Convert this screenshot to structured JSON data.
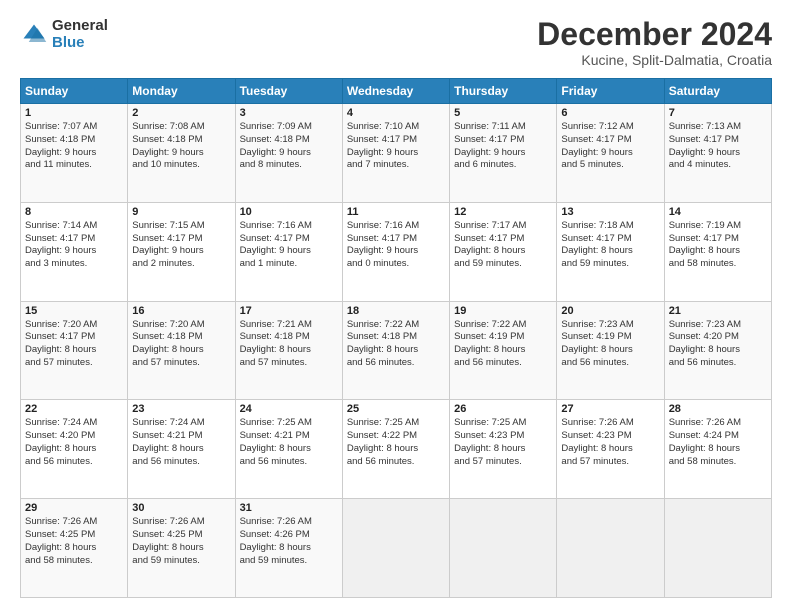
{
  "header": {
    "logo_general": "General",
    "logo_blue": "Blue",
    "month_title": "December 2024",
    "location": "Kucine, Split-Dalmatia, Croatia"
  },
  "days_of_week": [
    "Sunday",
    "Monday",
    "Tuesday",
    "Wednesday",
    "Thursday",
    "Friday",
    "Saturday"
  ],
  "weeks": [
    [
      {
        "day": "1",
        "lines": [
          "Sunrise: 7:07 AM",
          "Sunset: 4:18 PM",
          "Daylight: 9 hours",
          "and 11 minutes."
        ]
      },
      {
        "day": "2",
        "lines": [
          "Sunrise: 7:08 AM",
          "Sunset: 4:18 PM",
          "Daylight: 9 hours",
          "and 10 minutes."
        ]
      },
      {
        "day": "3",
        "lines": [
          "Sunrise: 7:09 AM",
          "Sunset: 4:18 PM",
          "Daylight: 9 hours",
          "and 8 minutes."
        ]
      },
      {
        "day": "4",
        "lines": [
          "Sunrise: 7:10 AM",
          "Sunset: 4:17 PM",
          "Daylight: 9 hours",
          "and 7 minutes."
        ]
      },
      {
        "day": "5",
        "lines": [
          "Sunrise: 7:11 AM",
          "Sunset: 4:17 PM",
          "Daylight: 9 hours",
          "and 6 minutes."
        ]
      },
      {
        "day": "6",
        "lines": [
          "Sunrise: 7:12 AM",
          "Sunset: 4:17 PM",
          "Daylight: 9 hours",
          "and 5 minutes."
        ]
      },
      {
        "day": "7",
        "lines": [
          "Sunrise: 7:13 AM",
          "Sunset: 4:17 PM",
          "Daylight: 9 hours",
          "and 4 minutes."
        ]
      }
    ],
    [
      {
        "day": "8",
        "lines": [
          "Sunrise: 7:14 AM",
          "Sunset: 4:17 PM",
          "Daylight: 9 hours",
          "and 3 minutes."
        ]
      },
      {
        "day": "9",
        "lines": [
          "Sunrise: 7:15 AM",
          "Sunset: 4:17 PM",
          "Daylight: 9 hours",
          "and 2 minutes."
        ]
      },
      {
        "day": "10",
        "lines": [
          "Sunrise: 7:16 AM",
          "Sunset: 4:17 PM",
          "Daylight: 9 hours",
          "and 1 minute."
        ]
      },
      {
        "day": "11",
        "lines": [
          "Sunrise: 7:16 AM",
          "Sunset: 4:17 PM",
          "Daylight: 9 hours",
          "and 0 minutes."
        ]
      },
      {
        "day": "12",
        "lines": [
          "Sunrise: 7:17 AM",
          "Sunset: 4:17 PM",
          "Daylight: 8 hours",
          "and 59 minutes."
        ]
      },
      {
        "day": "13",
        "lines": [
          "Sunrise: 7:18 AM",
          "Sunset: 4:17 PM",
          "Daylight: 8 hours",
          "and 59 minutes."
        ]
      },
      {
        "day": "14",
        "lines": [
          "Sunrise: 7:19 AM",
          "Sunset: 4:17 PM",
          "Daylight: 8 hours",
          "and 58 minutes."
        ]
      }
    ],
    [
      {
        "day": "15",
        "lines": [
          "Sunrise: 7:20 AM",
          "Sunset: 4:17 PM",
          "Daylight: 8 hours",
          "and 57 minutes."
        ]
      },
      {
        "day": "16",
        "lines": [
          "Sunrise: 7:20 AM",
          "Sunset: 4:18 PM",
          "Daylight: 8 hours",
          "and 57 minutes."
        ]
      },
      {
        "day": "17",
        "lines": [
          "Sunrise: 7:21 AM",
          "Sunset: 4:18 PM",
          "Daylight: 8 hours",
          "and 57 minutes."
        ]
      },
      {
        "day": "18",
        "lines": [
          "Sunrise: 7:22 AM",
          "Sunset: 4:18 PM",
          "Daylight: 8 hours",
          "and 56 minutes."
        ]
      },
      {
        "day": "19",
        "lines": [
          "Sunrise: 7:22 AM",
          "Sunset: 4:19 PM",
          "Daylight: 8 hours",
          "and 56 minutes."
        ]
      },
      {
        "day": "20",
        "lines": [
          "Sunrise: 7:23 AM",
          "Sunset: 4:19 PM",
          "Daylight: 8 hours",
          "and 56 minutes."
        ]
      },
      {
        "day": "21",
        "lines": [
          "Sunrise: 7:23 AM",
          "Sunset: 4:20 PM",
          "Daylight: 8 hours",
          "and 56 minutes."
        ]
      }
    ],
    [
      {
        "day": "22",
        "lines": [
          "Sunrise: 7:24 AM",
          "Sunset: 4:20 PM",
          "Daylight: 8 hours",
          "and 56 minutes."
        ]
      },
      {
        "day": "23",
        "lines": [
          "Sunrise: 7:24 AM",
          "Sunset: 4:21 PM",
          "Daylight: 8 hours",
          "and 56 minutes."
        ]
      },
      {
        "day": "24",
        "lines": [
          "Sunrise: 7:25 AM",
          "Sunset: 4:21 PM",
          "Daylight: 8 hours",
          "and 56 minutes."
        ]
      },
      {
        "day": "25",
        "lines": [
          "Sunrise: 7:25 AM",
          "Sunset: 4:22 PM",
          "Daylight: 8 hours",
          "and 56 minutes."
        ]
      },
      {
        "day": "26",
        "lines": [
          "Sunrise: 7:25 AM",
          "Sunset: 4:23 PM",
          "Daylight: 8 hours",
          "and 57 minutes."
        ]
      },
      {
        "day": "27",
        "lines": [
          "Sunrise: 7:26 AM",
          "Sunset: 4:23 PM",
          "Daylight: 8 hours",
          "and 57 minutes."
        ]
      },
      {
        "day": "28",
        "lines": [
          "Sunrise: 7:26 AM",
          "Sunset: 4:24 PM",
          "Daylight: 8 hours",
          "and 58 minutes."
        ]
      }
    ],
    [
      {
        "day": "29",
        "lines": [
          "Sunrise: 7:26 AM",
          "Sunset: 4:25 PM",
          "Daylight: 8 hours",
          "and 58 minutes."
        ]
      },
      {
        "day": "30",
        "lines": [
          "Sunrise: 7:26 AM",
          "Sunset: 4:25 PM",
          "Daylight: 8 hours",
          "and 59 minutes."
        ]
      },
      {
        "day": "31",
        "lines": [
          "Sunrise: 7:26 AM",
          "Sunset: 4:26 PM",
          "Daylight: 8 hours",
          "and 59 minutes."
        ]
      },
      {
        "day": "",
        "lines": []
      },
      {
        "day": "",
        "lines": []
      },
      {
        "day": "",
        "lines": []
      },
      {
        "day": "",
        "lines": []
      }
    ]
  ]
}
